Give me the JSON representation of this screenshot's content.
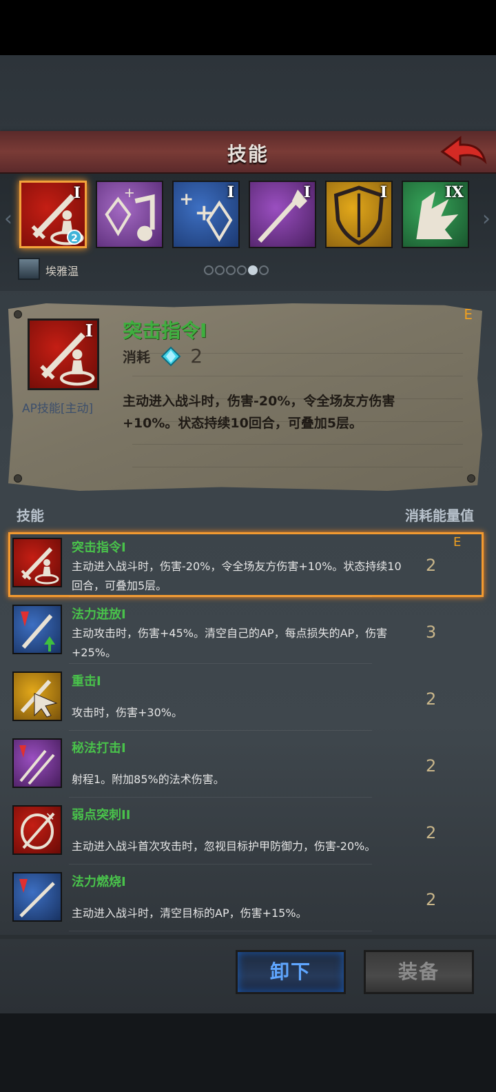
{
  "header": {
    "title": "技能"
  },
  "tiles": [
    {
      "rank": "I",
      "badge": "2",
      "colors": [
        "#c41e14",
        "#7a0d08"
      ],
      "icon": "sword-ap-icon"
    },
    {
      "rank": "",
      "colors": [
        "#a56bc4",
        "#5a2c78"
      ],
      "icon": "gem-music-icon"
    },
    {
      "rank": "I",
      "colors": [
        "#3d6fc2",
        "#1d3b74"
      ],
      "icon": "plus-gem-icon"
    },
    {
      "rank": "I",
      "colors": [
        "#9a4fc0",
        "#4f2266"
      ],
      "icon": "spear-icon"
    },
    {
      "rank": "I",
      "colors": [
        "#e2a81a",
        "#8a6010"
      ],
      "icon": "shield-icon"
    },
    {
      "rank": "IX",
      "colors": [
        "#37a65a",
        "#1b5a30"
      ],
      "icon": "claw-icon"
    }
  ],
  "character": {
    "name": "埃雅温"
  },
  "pager": {
    "count": 6,
    "active": 5
  },
  "detail": {
    "name": "突击指令I",
    "grade": "E",
    "rank": "I",
    "cost_label": "消耗",
    "cost_value": "2",
    "type_label": "AP技能[主动]",
    "description": "主动进入战斗时，伤害-20%，令全场友方伤害+10%。状态持续10回合，可叠加5层。"
  },
  "list_header": {
    "left": "技能",
    "right": "消耗能量值"
  },
  "skills": [
    {
      "name": "突击指令I",
      "desc": "主动进入战斗时，伤害-20%，令全场友方伤害+10%。状态持续10回合，可叠加5层。",
      "cost": "2",
      "grade": "E",
      "colors": [
        "#c41e14",
        "#6e0c07"
      ],
      "icon": "sword-ap-icon"
    },
    {
      "name": "法力迸放I",
      "desc": "主动攻击时，伤害+45%。清空自己的AP，每点损失的AP，伤害+25%。",
      "cost": "3",
      "grade": "",
      "colors": [
        "#3d6fc2",
        "#1a3566"
      ],
      "icon": "sword-up-icon"
    },
    {
      "name": "重击I",
      "desc": "攻击时，伤害+30%。",
      "cost": "2",
      "grade": "",
      "colors": [
        "#e2a81a",
        "#7e560c"
      ],
      "icon": "sword-cursor-icon"
    },
    {
      "name": "秘法打击I",
      "desc": "射程1。附加85%的法术伤害。",
      "cost": "2",
      "grade": "",
      "colors": [
        "#9a4fc0",
        "#4a1f60"
      ],
      "icon": "spear-pair-icon"
    },
    {
      "name": "弱点突刺II",
      "desc": "主动进入战斗首次攻击时，忽视目标护甲防御力，伤害-20%。",
      "cost": "2",
      "grade": "",
      "colors": [
        "#c41e14",
        "#6e0c07"
      ],
      "icon": "shield-pierce-icon"
    },
    {
      "name": "法力燃烧I",
      "desc": "主动进入战斗时，清空目标的AP，伤害+15%。",
      "cost": "2",
      "grade": "",
      "colors": [
        "#3d6fc2",
        "#1a3566"
      ],
      "icon": "spear-burn-icon"
    }
  ],
  "buttons": {
    "unequip": "卸下",
    "equip": "装备"
  }
}
